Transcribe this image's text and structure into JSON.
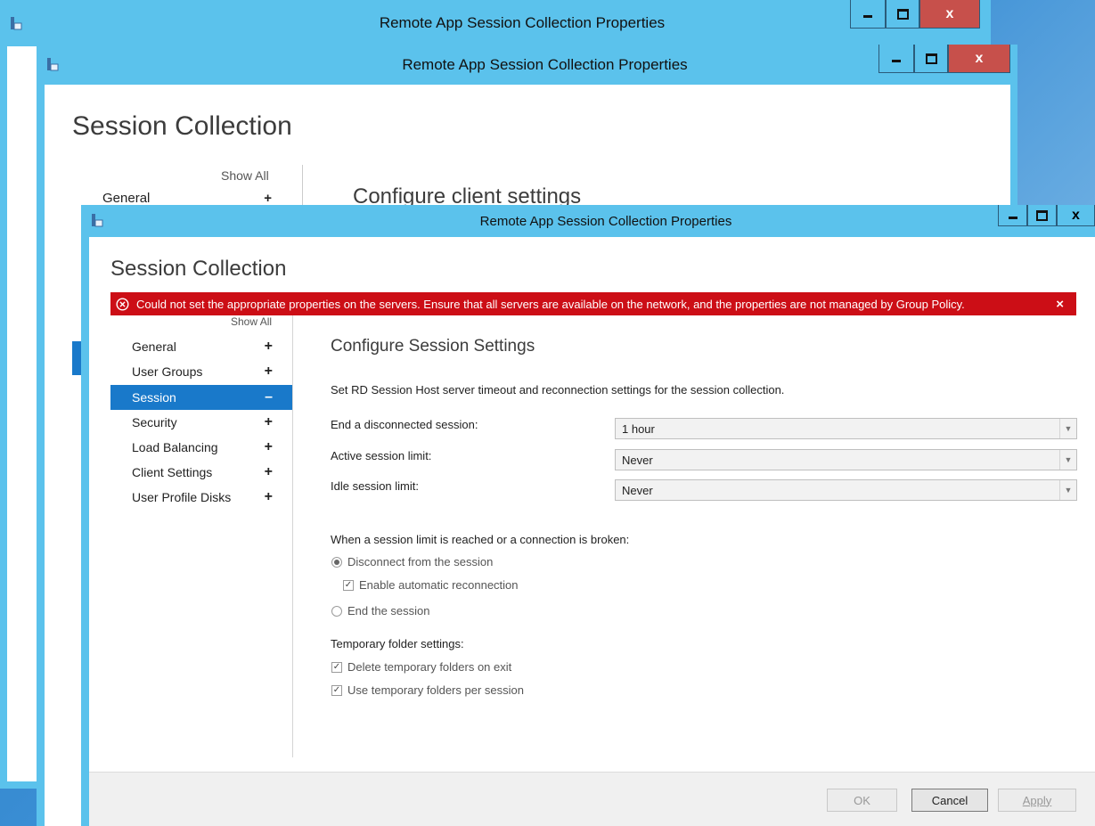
{
  "window_title": "Remote App Session Collection Properties",
  "page_heading": "Session Collection",
  "back_window": {
    "show_all": "Show All",
    "nav_general": "General",
    "nav_general_sign": "+",
    "configure_heading": "Configure client settings"
  },
  "error_banner": {
    "message": "Could not set the appropriate properties on the servers. Ensure that all servers are available on the network, and the properties are not managed by Group Policy.",
    "close": "×",
    "icon": "error-circle-icon"
  },
  "nav": {
    "show_all": "Show All",
    "items": [
      {
        "label": "General",
        "sign": "+"
      },
      {
        "label": "User Groups",
        "sign": "+"
      },
      {
        "label": "Session",
        "sign": "–"
      },
      {
        "label": "Security",
        "sign": "+"
      },
      {
        "label": "Load Balancing",
        "sign": "+"
      },
      {
        "label": "Client Settings",
        "sign": "+"
      },
      {
        "label": "User Profile Disks",
        "sign": "+"
      }
    ]
  },
  "main": {
    "section_title": "Configure Session Settings",
    "description": "Set RD Session Host server timeout and reconnection settings for the session collection.",
    "end_disconnected_label": "End a disconnected session:",
    "end_disconnected_value": "1 hour",
    "active_limit_label": "Active session limit:",
    "active_limit_value": "Never",
    "idle_limit_label": "Idle session limit:",
    "idle_limit_value": "Never",
    "limit_reached_label": "When a session limit is reached or a connection is broken:",
    "disconnect_option": "Disconnect from the session",
    "auto_reconnect_option": "Enable automatic reconnection",
    "end_session_option": "End the session",
    "temp_folder_label": "Temporary folder settings:",
    "delete_temp_option": "Delete temporary folders on exit",
    "use_temp_option": "Use temporary folders per session"
  },
  "buttons": {
    "ok": "OK",
    "cancel": "Cancel",
    "apply": "Apply"
  },
  "controls": {
    "minimize": "minimize-icon",
    "maximize": "maximize-icon",
    "close_glyph": "x"
  },
  "colors": {
    "titlebar": "#5bc2ec",
    "error": "#cc0e16",
    "selected": "#1979ca",
    "close_button": "#c7504b"
  }
}
